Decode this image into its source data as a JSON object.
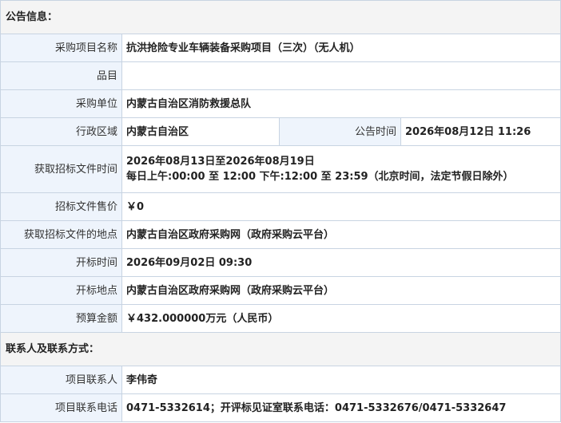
{
  "announcement_section": {
    "title": "公告信息：",
    "rows": {
      "project_name": {
        "label": "采购项目名称",
        "value": "抗洪抢险专业车辆装备采购项目（三次）（无人机）"
      },
      "item": {
        "label": "品目",
        "value": ""
      },
      "purchaser": {
        "label": "采购单位",
        "value": "内蒙古自治区消防救援总队"
      },
      "region": {
        "label": "行政区域",
        "value": "内蒙古自治区"
      },
      "announce_time": {
        "label": "公告时间",
        "value": "2026年08月12日 11:26"
      },
      "doc_period": {
        "label": "获取招标文件时间",
        "value_line1": "2026年08月13日至2026年08月19日",
        "value_line2": "每日上午:00:00 至 12:00  下午:12:00 至 23:59（北京时间，法定节假日除外）"
      },
      "doc_price": {
        "label": "招标文件售价",
        "value": "￥0"
      },
      "doc_location": {
        "label": "获取招标文件的地点",
        "value": "内蒙古自治区政府采购网（政府采购云平台）"
      },
      "bid_open_time": {
        "label": "开标时间",
        "value": "2026年09月02日 09:30"
      },
      "bid_open_location": {
        "label": "开标地点",
        "value": "内蒙古自治区政府采购网（政府采购云平台）"
      },
      "budget": {
        "label": "预算金额",
        "value": "￥432.000000万元（人民币）"
      }
    }
  },
  "contact_section": {
    "title": "联系人及联系方式：",
    "rows": {
      "contact_person": {
        "label": "项目联系人",
        "value": "李伟奇"
      },
      "contact_phone": {
        "label": "项目联系电话",
        "value": "0471-5332614；开评标见证室联系电话：0471-5332676/0471-5332647"
      }
    }
  }
}
